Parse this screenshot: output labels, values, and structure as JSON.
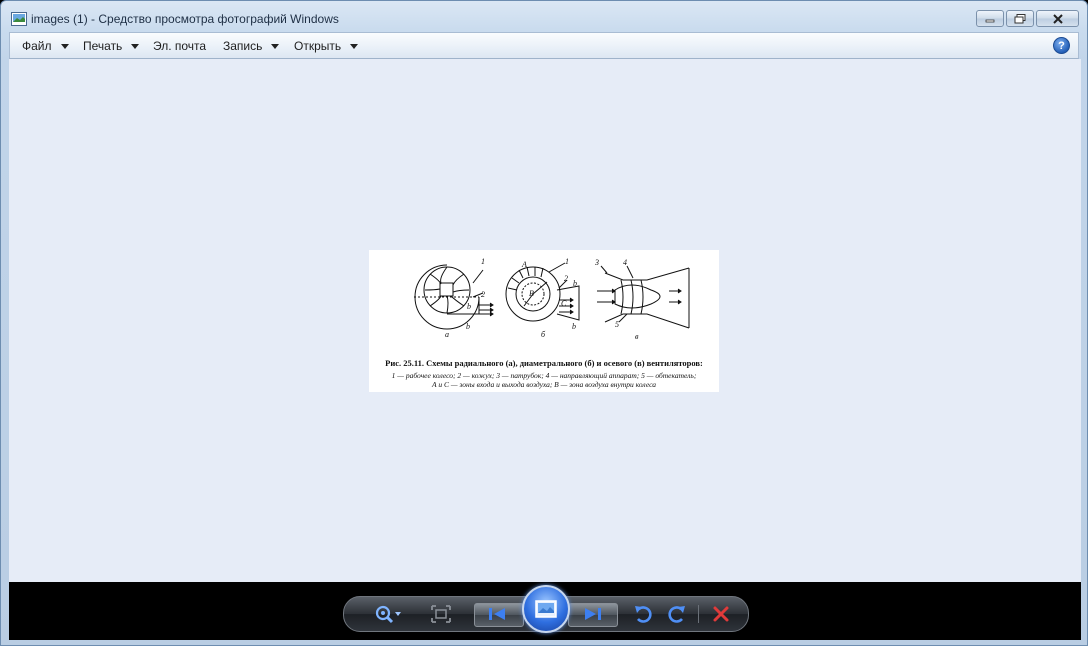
{
  "window": {
    "title": "images (1) - Средство просмотра фотографий Windows"
  },
  "menu": {
    "items": [
      {
        "label": "Файл",
        "has_dropdown": true
      },
      {
        "label": "Печать",
        "has_dropdown": true
      },
      {
        "label": "Эл. почта",
        "has_dropdown": false
      },
      {
        "label": "Запись",
        "has_dropdown": true
      },
      {
        "label": "Открыть",
        "has_dropdown": true
      }
    ],
    "help_label": "?"
  },
  "photo": {
    "diagram_labels": {
      "a_1": "1",
      "a_2": "2",
      "a_b1": "b",
      "a_b2": "b",
      "a_caption": "а",
      "b_1": "1",
      "b_2": "2",
      "b_A": "A",
      "b_C": "C",
      "b_B": "B",
      "b_b1": "b",
      "b_b2": "b",
      "b_caption": "б",
      "c_3": "3",
      "c_4": "4",
      "c_5": "5",
      "c_caption": "в"
    },
    "caption_title": "Рис. 25.11. Схемы радиального (а), диаметрального (б) и осевого (в) вентиляторов:",
    "caption_line1": "1 — рабочее колесо; 2 — кожух; 3 — патрубок; 4 — направляющий аппарат; 5 — обтекатель;",
    "caption_line2": "A и C — зоны входа и выхода воздуха; B — зона воздуха внутри колеса"
  },
  "toolbar": {
    "icons": [
      "zoom-icon",
      "fit-to-window-icon",
      "previous-icon",
      "slideshow-icon",
      "next-icon",
      "rotate-counterclockwise-icon",
      "rotate-clockwise-icon",
      "delete-icon"
    ],
    "accent": "#2f6fe0",
    "delete_color": "#d83030"
  }
}
